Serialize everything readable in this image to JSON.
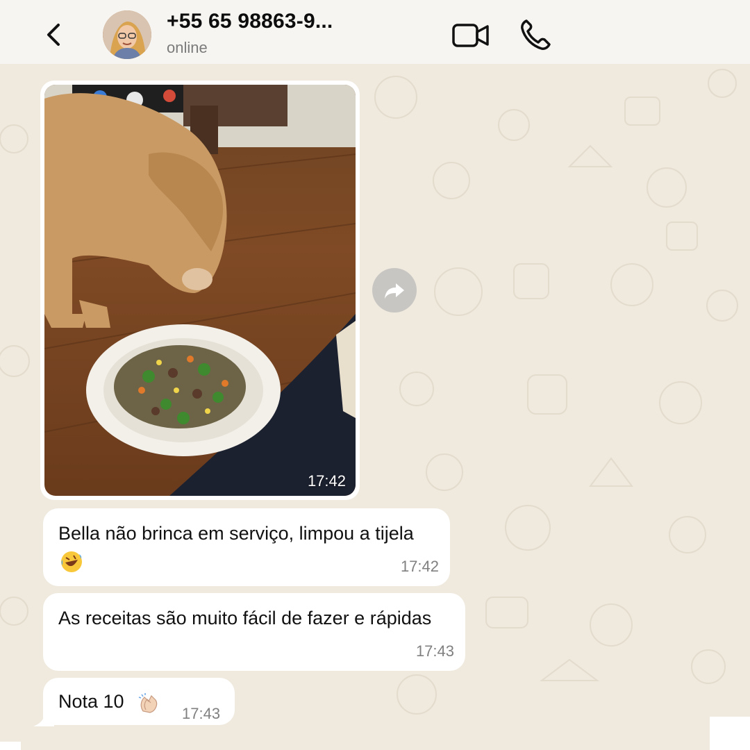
{
  "header": {
    "contact_name": "+55 65 98863-9...",
    "status": "online"
  },
  "messages": [
    {
      "type": "image",
      "time": "17:42",
      "alt": "dog eating food from a bowl"
    },
    {
      "type": "text",
      "text": "Bella não brinca em serviço, limpou a tijela",
      "emoji": "rolling-on-floor-laughing",
      "time": "17:42"
    },
    {
      "type": "text",
      "text": "As receitas são muito fácil de fazer e rápidas",
      "time": "17:43"
    },
    {
      "type": "text",
      "text": "Nota 10",
      "emoji": "clapping-hands",
      "time": "17:43"
    }
  ],
  "icons": {
    "back": "chevron-left-icon",
    "video": "video-camera-icon",
    "call": "phone-icon",
    "forward": "forward-arrow-icon"
  },
  "colors": {
    "wallpaper": "#efe9de",
    "header": "#f6f5f1",
    "bubble": "#ffffff",
    "time_text": "#808080"
  }
}
